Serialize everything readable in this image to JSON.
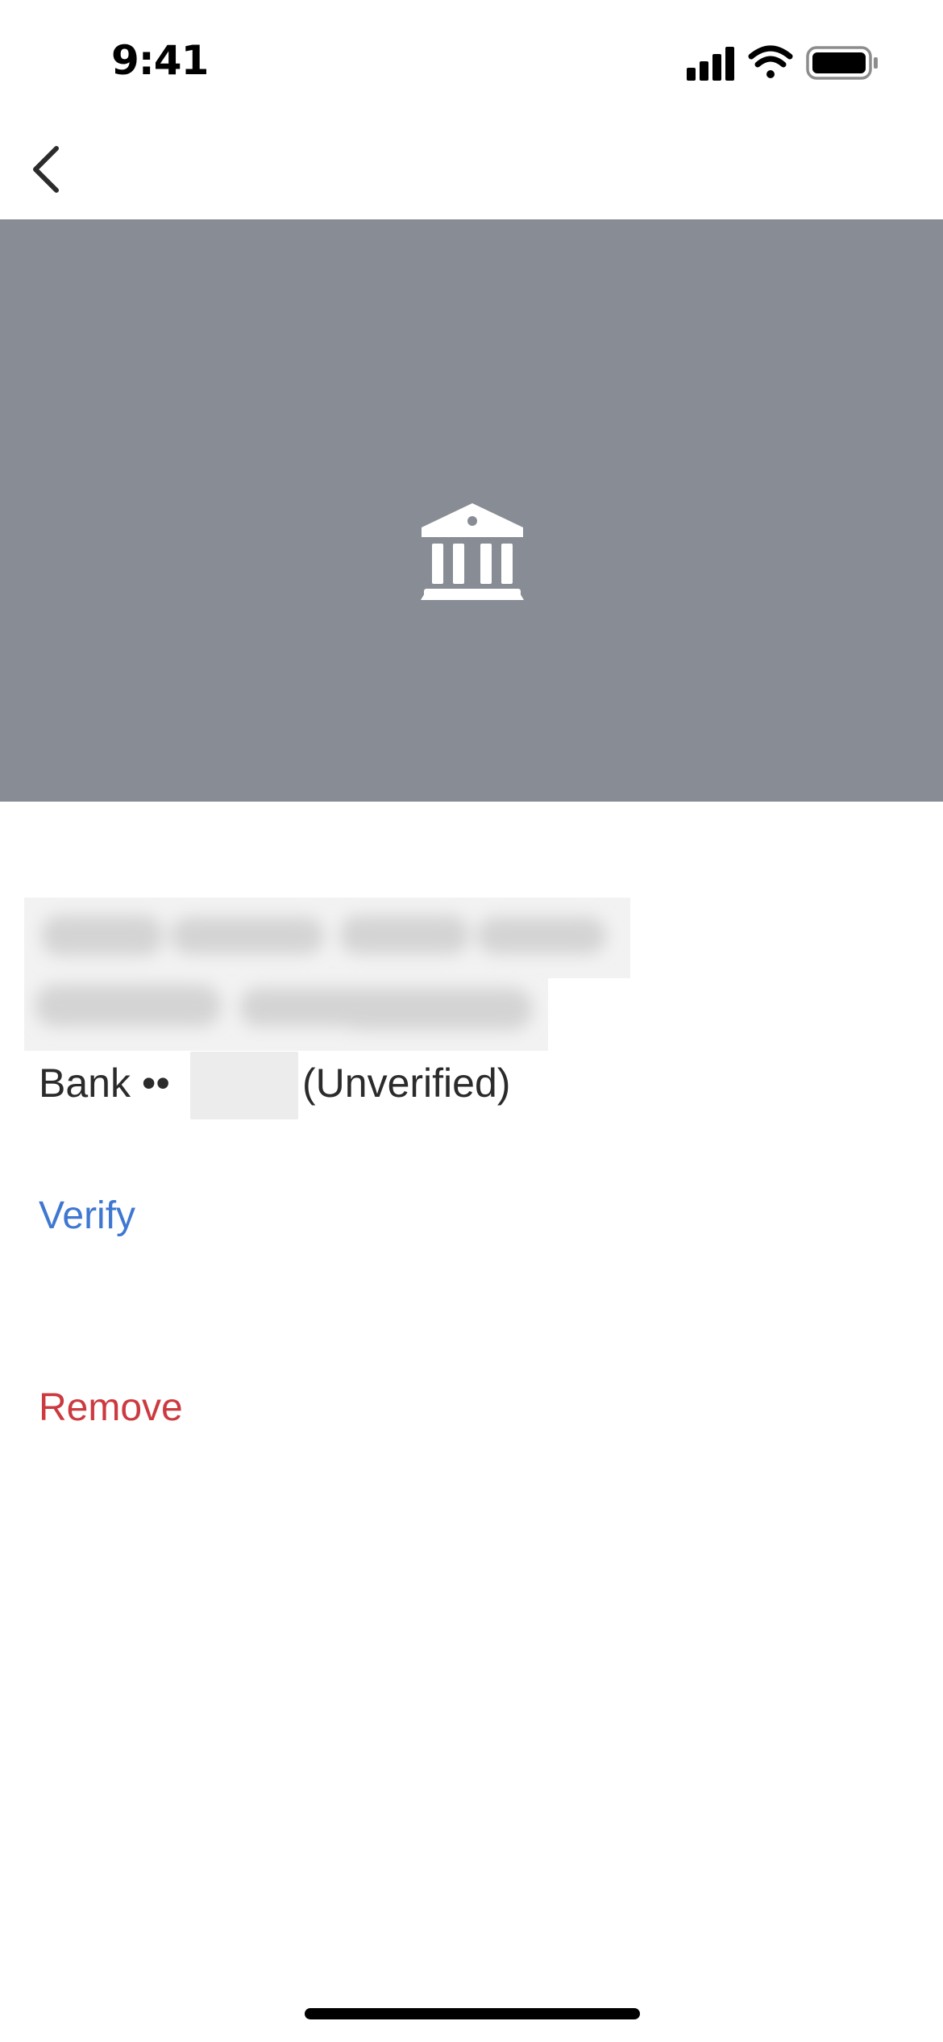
{
  "status_bar": {
    "time": "9:41",
    "icons": [
      "cellular-signal-icon",
      "wifi-icon",
      "battery-icon"
    ]
  },
  "nav": {
    "back_icon": "chevron-left-icon"
  },
  "hero": {
    "background_color": "#888c94",
    "icon": "bank-icon"
  },
  "account": {
    "prefix": "Bank ••",
    "status": "(Unverified)"
  },
  "actions": {
    "verify_label": "Verify",
    "remove_label": "Remove"
  },
  "colors": {
    "link_blue": "#3f77d1",
    "destructive_red": "#cc3a40",
    "text_dark": "#2b2b2b"
  }
}
